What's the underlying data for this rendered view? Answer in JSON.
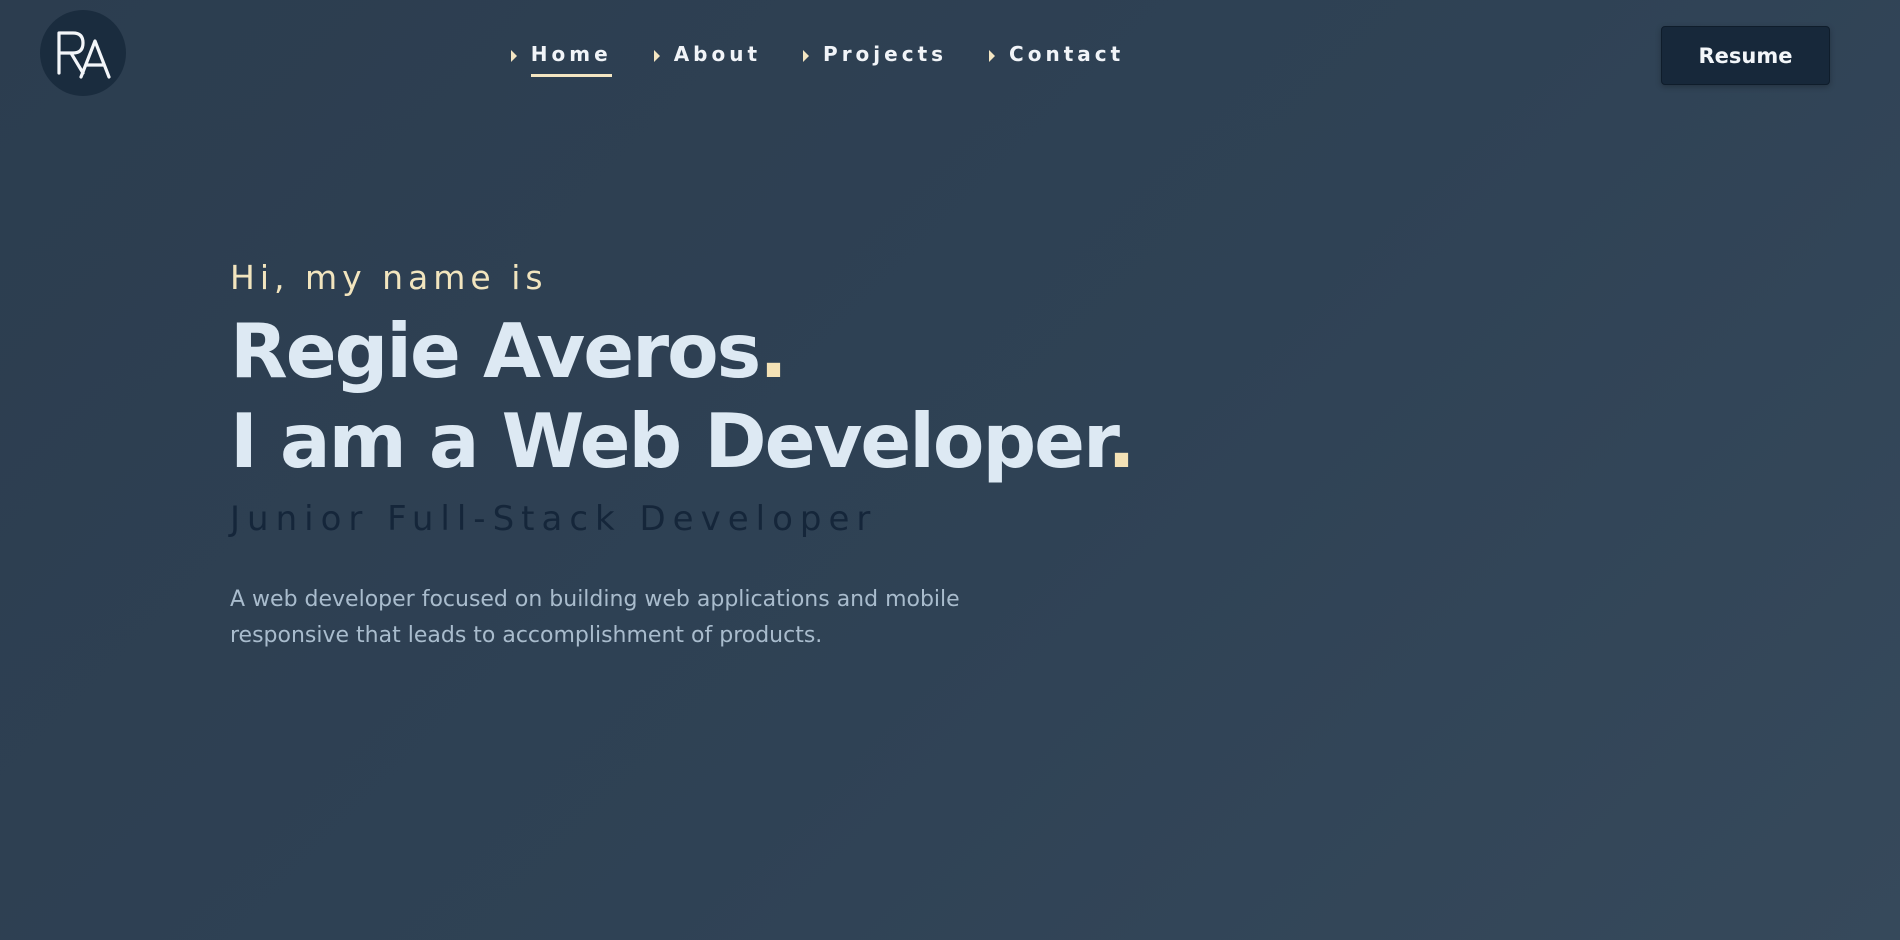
{
  "logo": {
    "text": "RA",
    "icon": "ra-monogram-icon"
  },
  "nav": {
    "items": [
      {
        "label": "Home",
        "active": true
      },
      {
        "label": "About",
        "active": false
      },
      {
        "label": "Projects",
        "active": false
      },
      {
        "label": "Contact",
        "active": false
      }
    ]
  },
  "header": {
    "resume_label": "Resume"
  },
  "hero": {
    "greeting": "Hi, my name is",
    "name": "Regie Averos",
    "role": "I am a Web Developer",
    "dot": ".",
    "subtitle": "Junior Full-Stack Developer",
    "description": "A web developer focused on building web applications and mobile responsive that leads to accomplishment of products."
  },
  "colors": {
    "background": "#2f4255",
    "accent": "#f4e6c2",
    "heading": "#dde9f3",
    "subtitle": "#15263a",
    "body_text": "#a9bccd",
    "button_bg": "#17283a"
  }
}
